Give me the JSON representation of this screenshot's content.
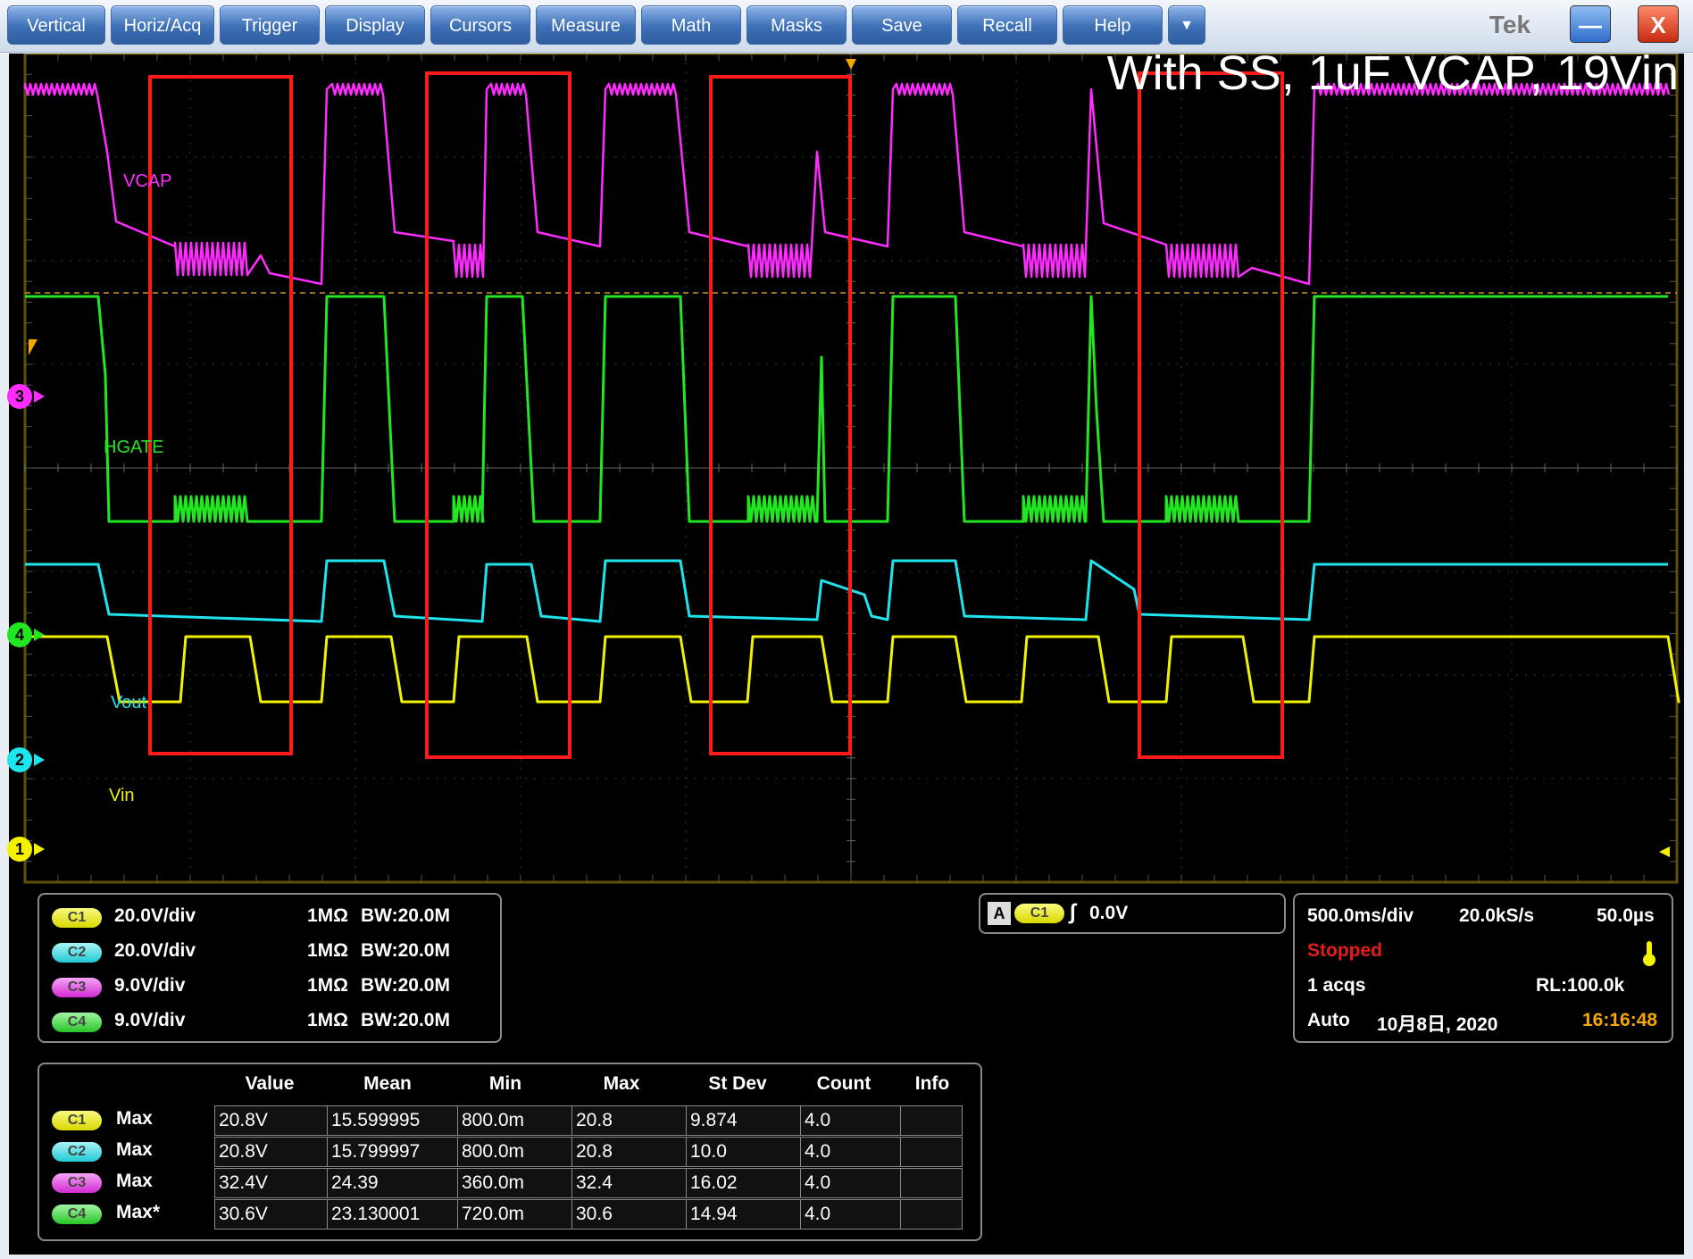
{
  "menu": {
    "items": [
      "Vertical",
      "Horiz/Acq",
      "Trigger",
      "Display",
      "Cursors",
      "Measure",
      "Math",
      "Masks",
      "Save",
      "Recall",
      "Help"
    ],
    "dropdown": "▼",
    "brand": "Tek",
    "minimize": "—",
    "close": "X"
  },
  "overlay_title": "With SS, 1uF VCAP, 19Vin",
  "traces": {
    "vcap": "VCAP",
    "hgate": "HGATE",
    "vout": "Vout",
    "vin": "Vin"
  },
  "markers": [
    "3",
    "4",
    "2",
    "1"
  ],
  "colors": {
    "c1": "#f2f200",
    "c2": "#1ee4ee",
    "c3": "#ff2cff",
    "c4": "#23e623",
    "highlight": "#ff1a1a"
  },
  "channels": [
    {
      "chip": "C1",
      "scale": "20.0V/div",
      "imp": "1MΩ",
      "bw": "BW:20.0M"
    },
    {
      "chip": "C2",
      "scale": "20.0V/div",
      "imp": "1MΩ",
      "bw": "BW:20.0M"
    },
    {
      "chip": "C3",
      "scale": "9.0V/div",
      "imp": "1MΩ",
      "bw": "BW:20.0M"
    },
    {
      "chip": "C4",
      "scale": "9.0V/div",
      "imp": "1MΩ",
      "bw": "BW:20.0M"
    }
  ],
  "trigger": {
    "mode": "A",
    "source": "C1",
    "slope": "∫",
    "level": "0.0V"
  },
  "acquisition": {
    "timebase": "500.0ms/div",
    "sample_rate": "20.0kS/s",
    "resolution": "50.0µs",
    "state": "Stopped",
    "acqs": "1 acqs",
    "record_length": "RL:100.0k",
    "mode": "Auto",
    "date": "10月8日, 2020",
    "time": "16:16:48"
  },
  "measurements": {
    "headers": [
      "Value",
      "Mean",
      "Min",
      "Max",
      "St Dev",
      "Count",
      "Info"
    ],
    "rows": [
      {
        "chip": "C1",
        "type": "Max",
        "cells": [
          "20.8V",
          "15.599995",
          "800.0m",
          "20.8",
          "9.874",
          "4.0",
          ""
        ]
      },
      {
        "chip": "C2",
        "type": "Max",
        "cells": [
          "20.8V",
          "15.799997",
          "800.0m",
          "20.8",
          "10.0",
          "4.0",
          ""
        ]
      },
      {
        "chip": "C3",
        "type": "Max",
        "cells": [
          "32.4V",
          "24.39",
          "360.0m",
          "32.4",
          "16.02",
          "4.0",
          ""
        ]
      },
      {
        "chip": "C4",
        "type": "Max*",
        "cells": [
          "30.6V",
          "23.130001",
          "720.0m",
          "30.6",
          "14.94",
          "4.0",
          ""
        ]
      }
    ]
  }
}
